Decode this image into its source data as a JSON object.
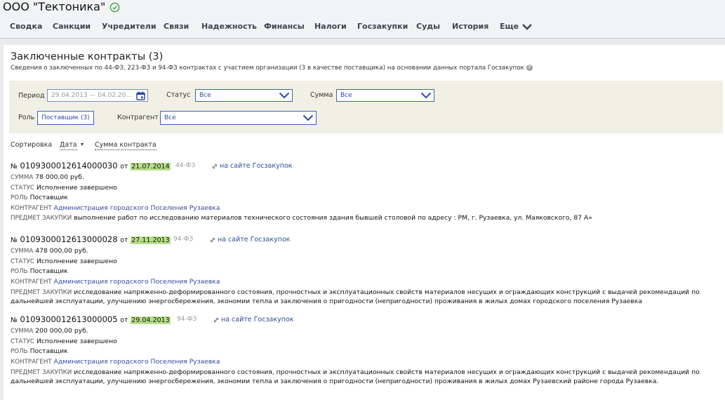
{
  "company": {
    "name": "ООО \"Тектоника\"",
    "status_icon": "check-circle-icon",
    "status_color": "#3aa541"
  },
  "tabs": [
    {
      "label": "Сводка"
    },
    {
      "label": "Санкции"
    },
    {
      "label": "Учредители"
    },
    {
      "label": "Связи"
    },
    {
      "label": "Надежность"
    },
    {
      "label": "Финансы"
    },
    {
      "label": "Налоги"
    },
    {
      "label": "Госзакупки"
    },
    {
      "label": "Суды"
    },
    {
      "label": "История"
    },
    {
      "label": "Еще"
    }
  ],
  "section": {
    "title": "Заключенные контракты (3)",
    "subtitle": "Сведения о заключенных по 44-ФЗ, 223-ФЗ и 94-ФЗ контрактах с участием организации (3 в качестве поставщика) на основании данных портала Госзакупок",
    "help_icon": "?"
  },
  "filters": {
    "period_label": "Период",
    "period_value": "29.04.2013 — 04.02.20...",
    "status_label": "Статус",
    "status_value": "Все",
    "sum_label": "Сумма",
    "sum_value": "Все",
    "role_label": "Роль",
    "role_value": "Поставщик (3)",
    "counterparty_label": "Контрагент",
    "counterparty_value": "Все"
  },
  "sorting": {
    "label": "Сортировка",
    "date": "Дата",
    "date_arrow": "▾",
    "sum": "Сумма контракта"
  },
  "labels": {
    "number_prefix": "№",
    "date_prefix": "от",
    "sum": "СУММА",
    "status": "СТАТУС",
    "role": "РОЛЬ",
    "counterparty": "КОНТРАГЕНТ",
    "subject": "ПРЕДМЕТ ЗАКУПКИ",
    "portal_link": "на сайте Госзакупок"
  },
  "contracts": [
    {
      "number": "0109300012614000030",
      "date": "21.07.2014",
      "law": "44-ФЗ",
      "sum": "78 000,00 руб.",
      "status": "Исполнение завершено",
      "role": "Поставщик",
      "counterparty": "Администрация городского Поселения Рузаевка",
      "subject": "выполнение работ по исследованию материалов технического состояния здания бывшей столовой по адресу : РМ, г. Рузаевка, ул. Маяковского, 87 А»"
    },
    {
      "number": "0109300012613000028",
      "date": "27.11.2013",
      "law": "94-ФЗ",
      "sum": "478 000,00 руб.",
      "status": "Исполнение завершено",
      "role": "Поставщик",
      "counterparty": "Администрация городского Поселения Рузаевка",
      "subject": "исследование напряженно-деформированного состояния, прочностных и эксплуатационных свойств материалов несущих и ограждающих конструкций с выдачей рекомендаций по дальнейшей эксплуатации, улучшению энергосбережения, экономии тепла и заключения о пригодности (непригодности) проживания в жилых домах городского поселения Рузаевка"
    },
    {
      "number": "0109300012613000005",
      "date": "29.04.2013",
      "law": "94-ФЗ",
      "sum": "200 000,00 руб.",
      "status": "Исполнение завершено",
      "role": "Поставщик",
      "counterparty": "Администрация городского Поселения Рузаевка",
      "subject": "исследование напряженно-деформированного состояния, прочностных и эксплуатационных свойств материалов несущих и ограждающих конструкций с выдачей рекомендаций по дальнейшей эксплуатации, улучшению энергосбережения, экономии тепла и заключения о пригодности (непригодности) проживания в жилых домах Рузаевский районе города Рузаевка."
    }
  ]
}
